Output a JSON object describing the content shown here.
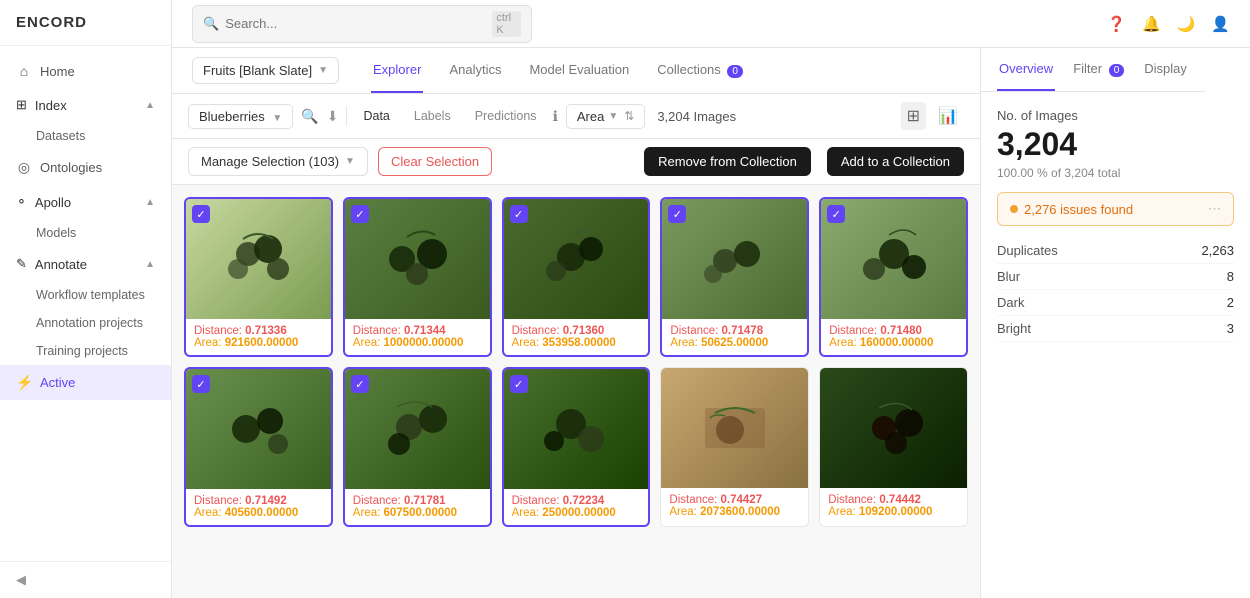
{
  "app": {
    "logo": "ENCORD"
  },
  "sidebar": {
    "nav_items": [
      {
        "id": "home",
        "label": "Home",
        "icon": "⌂"
      },
      {
        "id": "index",
        "label": "Index",
        "icon": "⊞",
        "expanded": true
      },
      {
        "id": "datasets",
        "label": "Datasets",
        "sub": true
      },
      {
        "id": "ontologies",
        "label": "Ontologies",
        "icon": "◎"
      },
      {
        "id": "apollo",
        "label": "Apollo",
        "icon": "⚬",
        "expanded": true
      },
      {
        "id": "models",
        "label": "Models",
        "sub": true
      },
      {
        "id": "annotate",
        "label": "Annotate",
        "icon": "✎",
        "expanded": true
      },
      {
        "id": "workflow-templates",
        "label": "Workflow templates",
        "sub": true
      },
      {
        "id": "annotation-projects",
        "label": "Annotation projects",
        "sub": true
      },
      {
        "id": "training-projects",
        "label": "Training projects",
        "sub": true
      },
      {
        "id": "active",
        "label": "Active",
        "icon": "⚡",
        "active": true
      }
    ],
    "collapse_label": "Collapse"
  },
  "header": {
    "search_placeholder": "Search...",
    "search_shortcut": "ctrl K",
    "icons": [
      "help",
      "bell",
      "moon",
      "user"
    ]
  },
  "tabs_bar": {
    "dataset_selector": "Fruits [Blank Slate]",
    "tabs": [
      {
        "id": "explorer",
        "label": "Explorer",
        "active": true
      },
      {
        "id": "analytics",
        "label": "Analytics"
      },
      {
        "id": "model-evaluation",
        "label": "Model Evaluation"
      },
      {
        "id": "collections",
        "label": "Collections",
        "badge": "0"
      }
    ]
  },
  "toolbar": {
    "filter_label": "Blueberries",
    "filter_buttons": [
      {
        "id": "data",
        "label": "Data",
        "active": true
      },
      {
        "id": "labels",
        "label": "Labels"
      },
      {
        "id": "predictions",
        "label": "Predictions"
      }
    ],
    "area_selector": "Area",
    "images_count": "3,204 Images",
    "view_grid": "⊞",
    "view_chart": "📊"
  },
  "selection_bar": {
    "manage_label": "Manage Selection (103)",
    "clear_label": "Clear Selection",
    "remove_label": "Remove from Collection",
    "add_label": "Add to a Collection"
  },
  "image_grid": {
    "images": [
      {
        "id": 1,
        "selected": true,
        "distance": "0.71336",
        "area": "921600.00000",
        "color": "#b8d4a0"
      },
      {
        "id": 2,
        "selected": true,
        "distance": "0.71344",
        "area": "1000000.00000",
        "color": "#8aab60"
      },
      {
        "id": 3,
        "selected": true,
        "distance": "0.71360",
        "area": "353958.00000",
        "color": "#6a8c55"
      },
      {
        "id": 4,
        "selected": true,
        "distance": "0.71478",
        "area": "50625.00000",
        "color": "#7a9c6a"
      },
      {
        "id": 5,
        "selected": true,
        "distance": "0.71480",
        "area": "160000.00000",
        "color": "#5a7c4a"
      },
      {
        "id": 6,
        "selected": true,
        "distance": "0.71492",
        "area": "405600.00000",
        "color": "#6a8c55"
      },
      {
        "id": 7,
        "selected": true,
        "distance": "0.71781",
        "area": "607500.00000",
        "color": "#8aab60"
      },
      {
        "id": 8,
        "selected": true,
        "distance": "0.72234",
        "area": "250000.00000",
        "color": "#5a7c4a"
      },
      {
        "id": 9,
        "selected": false,
        "distance": "0.74427",
        "area": "2073600.00000",
        "color": "#c8a870"
      },
      {
        "id": 10,
        "selected": false,
        "distance": "0.74442",
        "area": "109200.00000",
        "color": "#3a5c2a"
      }
    ]
  },
  "right_panel": {
    "tabs": [
      {
        "id": "overview",
        "label": "Overview",
        "active": true
      },
      {
        "id": "filter",
        "label": "Filter",
        "badge": "0"
      },
      {
        "id": "display",
        "label": "Display"
      }
    ],
    "stat_label": "No. of Images",
    "stat_value": "3,204",
    "stat_subtext": "100.00 % of 3,204 total",
    "issues_text": "2,276 issues found",
    "issues": [
      {
        "name": "Duplicates",
        "count": "2,263"
      },
      {
        "name": "Blur",
        "count": "8"
      },
      {
        "name": "Dark",
        "count": "2"
      },
      {
        "name": "Bright",
        "count": "3"
      }
    ]
  }
}
